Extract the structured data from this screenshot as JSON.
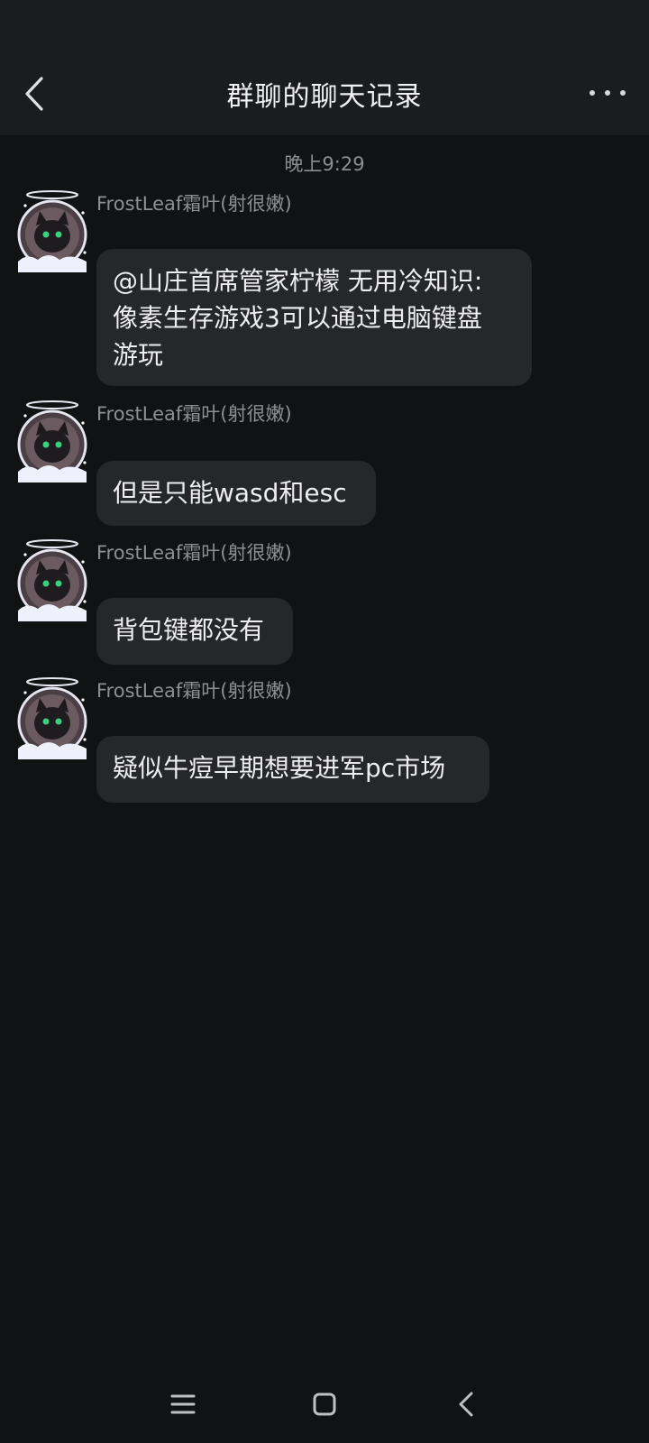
{
  "header": {
    "title": "群聊的聊天记录"
  },
  "timestamp": "晚上9:29",
  "messages": [
    {
      "sender": "FrostLeaf霜叶(射很嫩)",
      "lines": [
        "@山庄首席管家柠檬 无用冷知识:",
        "像素生存游戏3可以通过电脑键盘",
        "游玩"
      ]
    },
    {
      "sender": "FrostLeaf霜叶(射很嫩)",
      "lines": [
        "但是只能wasd和esc"
      ]
    },
    {
      "sender": "FrostLeaf霜叶(射很嫩)",
      "lines": [
        "背包键都没有"
      ]
    },
    {
      "sender": "FrostLeaf霜叶(射很嫩)",
      "lines": [
        "疑似牛痘早期想要进军pc市场"
      ]
    }
  ],
  "icons": {
    "back": "chevron-left-icon",
    "more": "more-dots-icon",
    "nav_menu": "menu-icon",
    "nav_home": "home-square-icon",
    "nav_back": "back-chevron-icon"
  }
}
